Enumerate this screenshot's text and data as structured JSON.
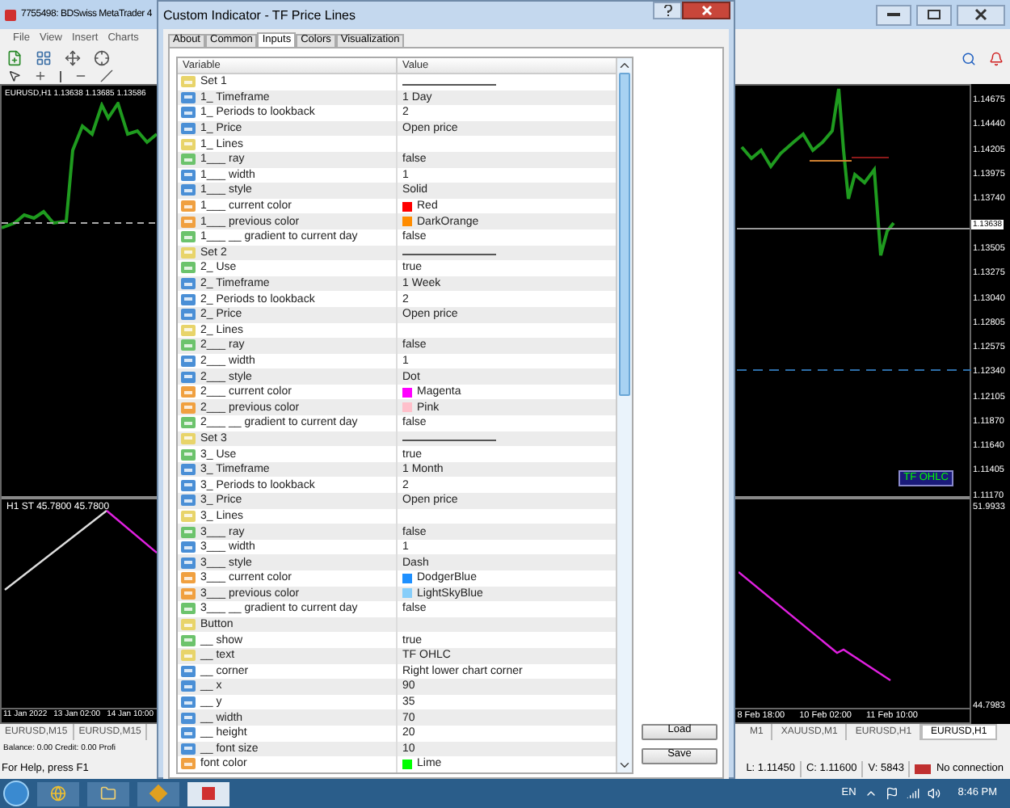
{
  "app": {
    "title": "7755498: BDSwiss MetaTrader 4",
    "menu": [
      "File",
      "View",
      "Insert",
      "Charts"
    ]
  },
  "chart": {
    "symbol_label": "EURUSD,H1 1.13638 1.13685 1.13586",
    "indicator_label": "H1 ST  45.7800 45.7800",
    "button": "TF OHLC",
    "price_scale": [
      {
        "label": "1.14675",
        "kind": "tick"
      },
      {
        "label": "1.14440",
        "kind": "tick"
      },
      {
        "label": "1.14205",
        "kind": "tick"
      },
      {
        "label": "1.13975",
        "kind": "tick"
      },
      {
        "label": "1.13740",
        "kind": "tick"
      },
      {
        "label": "1.13638",
        "kind": "current"
      },
      {
        "label": "1.13505",
        "kind": "tick"
      },
      {
        "label": "1.13275",
        "kind": "tick"
      },
      {
        "label": "1.13040",
        "kind": "tick"
      },
      {
        "label": "1.12805",
        "kind": "tick"
      },
      {
        "label": "1.12575",
        "kind": "tick"
      },
      {
        "label": "1.12340",
        "kind": "tick"
      },
      {
        "label": "1.12105",
        "kind": "tick"
      },
      {
        "label": "1.11870",
        "kind": "tick"
      },
      {
        "label": "1.11640",
        "kind": "tick"
      },
      {
        "label": "1.11405",
        "kind": "tick"
      },
      {
        "label": "1.11170",
        "kind": "tick"
      }
    ],
    "indicator_scale": [
      "51.9933",
      "44.7983"
    ],
    "time_axis_left": [
      "11 Jan 2022",
      "13 Jan 02:00",
      "14 Jan 10:00"
    ],
    "time_axis_right": [
      "8 Feb 18:00",
      "10 Feb 02:00",
      "11 Feb 10:00"
    ]
  },
  "chart_tabs_left": [
    {
      "label": "EURUSD,M15",
      "selected": false
    },
    {
      "label": "EURUSD,M15",
      "selected": false
    }
  ],
  "chart_tabs_right": [
    {
      "label": "M1",
      "selected": false
    },
    {
      "label": "XAUUSD,M1",
      "selected": false
    },
    {
      "label": "EURUSD,H1",
      "selected": false
    },
    {
      "label": "EURUSD,H1",
      "selected": true
    }
  ],
  "status": {
    "account": "Balance: 0.00 Credit: 0.00 Profi",
    "help": "For Help, press F1",
    "low": "L: 1.11450",
    "close": "C: 1.11600",
    "volume": "V: 5843",
    "connection": "No connection"
  },
  "dialog": {
    "title": "Custom Indicator - TF Price Lines",
    "tabs": [
      {
        "label": "About",
        "selected": false
      },
      {
        "label": "Common",
        "selected": false
      },
      {
        "label": "Inputs",
        "selected": true
      },
      {
        "label": "Colors",
        "selected": false
      },
      {
        "label": "Visualization",
        "selected": false
      }
    ],
    "columns": [
      "Variable",
      "Value"
    ],
    "rows": [
      {
        "kind": "group",
        "name": "Set 1",
        "separator": true
      },
      {
        "kind": "number",
        "name": "1_ Timeframe",
        "value": "1 Day",
        "separator": false
      },
      {
        "kind": "number",
        "name": "1_ Periods to lookback",
        "value": "2",
        "separator": false
      },
      {
        "kind": "number",
        "name": "1_ Price",
        "value": "Open price",
        "separator": false
      },
      {
        "kind": "group",
        "name": "1_ Lines",
        "separator": false
      },
      {
        "kind": "bool",
        "name": "1___ ray",
        "value": "false",
        "separator": false
      },
      {
        "kind": "number",
        "name": "1___ width",
        "value": "1",
        "separator": false
      },
      {
        "kind": "number",
        "name": "1___ style",
        "value": "Solid",
        "separator": false
      },
      {
        "kind": "color",
        "name": "1___ current color",
        "value": "Red",
        "color": "#ff0000",
        "separator": false
      },
      {
        "kind": "color",
        "name": "1___ previous color",
        "value": "DarkOrange",
        "color": "#ff8c00",
        "separator": false
      },
      {
        "kind": "bool",
        "name": "1___ __ gradient to current day",
        "value": "false",
        "separator": false
      },
      {
        "kind": "group",
        "name": "Set 2",
        "separator": true
      },
      {
        "kind": "bool",
        "name": "2_ Use",
        "value": "true",
        "separator": false
      },
      {
        "kind": "number",
        "name": "2_ Timeframe",
        "value": "1 Week",
        "separator": false
      },
      {
        "kind": "number",
        "name": "2_ Periods to lookback",
        "value": "2",
        "separator": false
      },
      {
        "kind": "number",
        "name": "2_ Price",
        "value": "Open price",
        "separator": false
      },
      {
        "kind": "group",
        "name": "2_ Lines",
        "separator": false
      },
      {
        "kind": "bool",
        "name": "2___ ray",
        "value": "false",
        "separator": false
      },
      {
        "kind": "number",
        "name": "2___ width",
        "value": "1",
        "separator": false
      },
      {
        "kind": "number",
        "name": "2___ style",
        "value": "Dot",
        "separator": false
      },
      {
        "kind": "color",
        "name": "2___ current color",
        "value": "Magenta",
        "color": "#ff00ff",
        "separator": false
      },
      {
        "kind": "color",
        "name": "2___ previous color",
        "value": "Pink",
        "color": "#ffc0cb",
        "separator": false
      },
      {
        "kind": "bool",
        "name": "2___ __ gradient to current day",
        "value": "false",
        "separator": false
      },
      {
        "kind": "group",
        "name": "Set 3",
        "separator": true
      },
      {
        "kind": "bool",
        "name": "3_ Use",
        "value": "true",
        "separator": false
      },
      {
        "kind": "number",
        "name": "3_ Timeframe",
        "value": "1 Month",
        "separator": false
      },
      {
        "kind": "number",
        "name": "3_ Periods to lookback",
        "value": "2",
        "separator": false
      },
      {
        "kind": "number",
        "name": "3_ Price",
        "value": "Open price",
        "separator": false
      },
      {
        "kind": "group",
        "name": "3_ Lines",
        "separator": false
      },
      {
        "kind": "bool",
        "name": "3___ ray",
        "value": "false",
        "separator": false
      },
      {
        "kind": "number",
        "name": "3___ width",
        "value": "1",
        "separator": false
      },
      {
        "kind": "number",
        "name": "3___ style",
        "value": "Dash",
        "separator": false
      },
      {
        "kind": "color",
        "name": "3___ current color",
        "value": "DodgerBlue",
        "color": "#1e90ff",
        "separator": false
      },
      {
        "kind": "color",
        "name": "3___ previous color",
        "value": "LightSkyBlue",
        "color": "#87cefa",
        "separator": false
      },
      {
        "kind": "bool",
        "name": "3___ __ gradient to current day",
        "value": "false",
        "separator": false
      },
      {
        "kind": "group",
        "name": "Button",
        "separator": false
      },
      {
        "kind": "bool",
        "name": "__ show",
        "value": "true",
        "separator": false
      },
      {
        "kind": "string",
        "name": "__ text",
        "value": "TF OHLC",
        "separator": false
      },
      {
        "kind": "number",
        "name": "__ corner",
        "value": "Right lower chart corner",
        "separator": false
      },
      {
        "kind": "number",
        "name": "__ x",
        "value": "90",
        "separator": false
      },
      {
        "kind": "number",
        "name": "__ y",
        "value": "35",
        "separator": false
      },
      {
        "kind": "number",
        "name": "__ width",
        "value": "70",
        "separator": false
      },
      {
        "kind": "number",
        "name": "__ height",
        "value": "20",
        "separator": false
      },
      {
        "kind": "number",
        "name": "__ font size",
        "value": "10",
        "separator": false
      },
      {
        "kind": "color",
        "name": "font color",
        "value": "Lime",
        "color": "#00ff00",
        "separator": false
      }
    ],
    "buttons": [
      "Load",
      "Save"
    ]
  },
  "taskbar": {
    "language": "EN",
    "time": "8:46 PM"
  }
}
